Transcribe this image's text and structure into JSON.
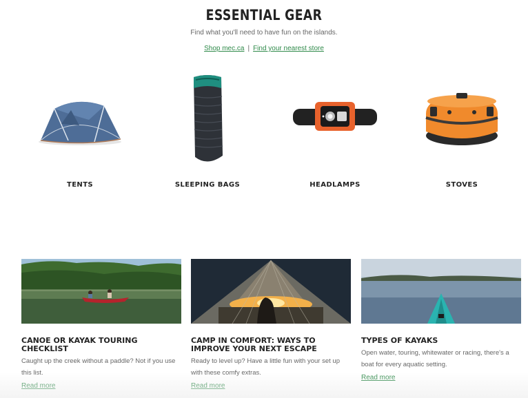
{
  "header": {
    "title": "ESSENTIAL GEAR",
    "subtitle": "Find what you'll need to have fun on the islands.",
    "link_shop": "Shop mec.ca",
    "separator": "|",
    "link_store": "Find your nearest store"
  },
  "categories": [
    {
      "label": "TENTS",
      "icon": "tent-image"
    },
    {
      "label": "SLEEPING BAGS",
      "icon": "sleeping-bag-image"
    },
    {
      "label": "HEADLAMPS",
      "icon": "headlamp-image"
    },
    {
      "label": "STOVES",
      "icon": "stove-image"
    }
  ],
  "articles": [
    {
      "title": "CANOE OR KAYAK TOURING CHECKLIST",
      "description": "Caught up the creek without a paddle? Not if you use this list.",
      "link": "Read more",
      "image": "canoe-on-lake-photo"
    },
    {
      "title": "CAMP IN COMFORT: WAYS TO IMPROVE YOUR NEXT ESCAPE",
      "description": "Ready to level up? Have a little fun with your set up with these comfy extras.",
      "link": "Read more",
      "image": "tent-sunset-photo"
    },
    {
      "title": "TYPES OF KAYAKS",
      "description": "Open water, touring, whitewater or racing, there's a boat for every aquatic setting.",
      "link": "Read more",
      "image": "kayak-bow-water-photo"
    }
  ],
  "colors": {
    "link": "#2f8a4a",
    "heading": "#222222",
    "body_text": "#666666"
  }
}
